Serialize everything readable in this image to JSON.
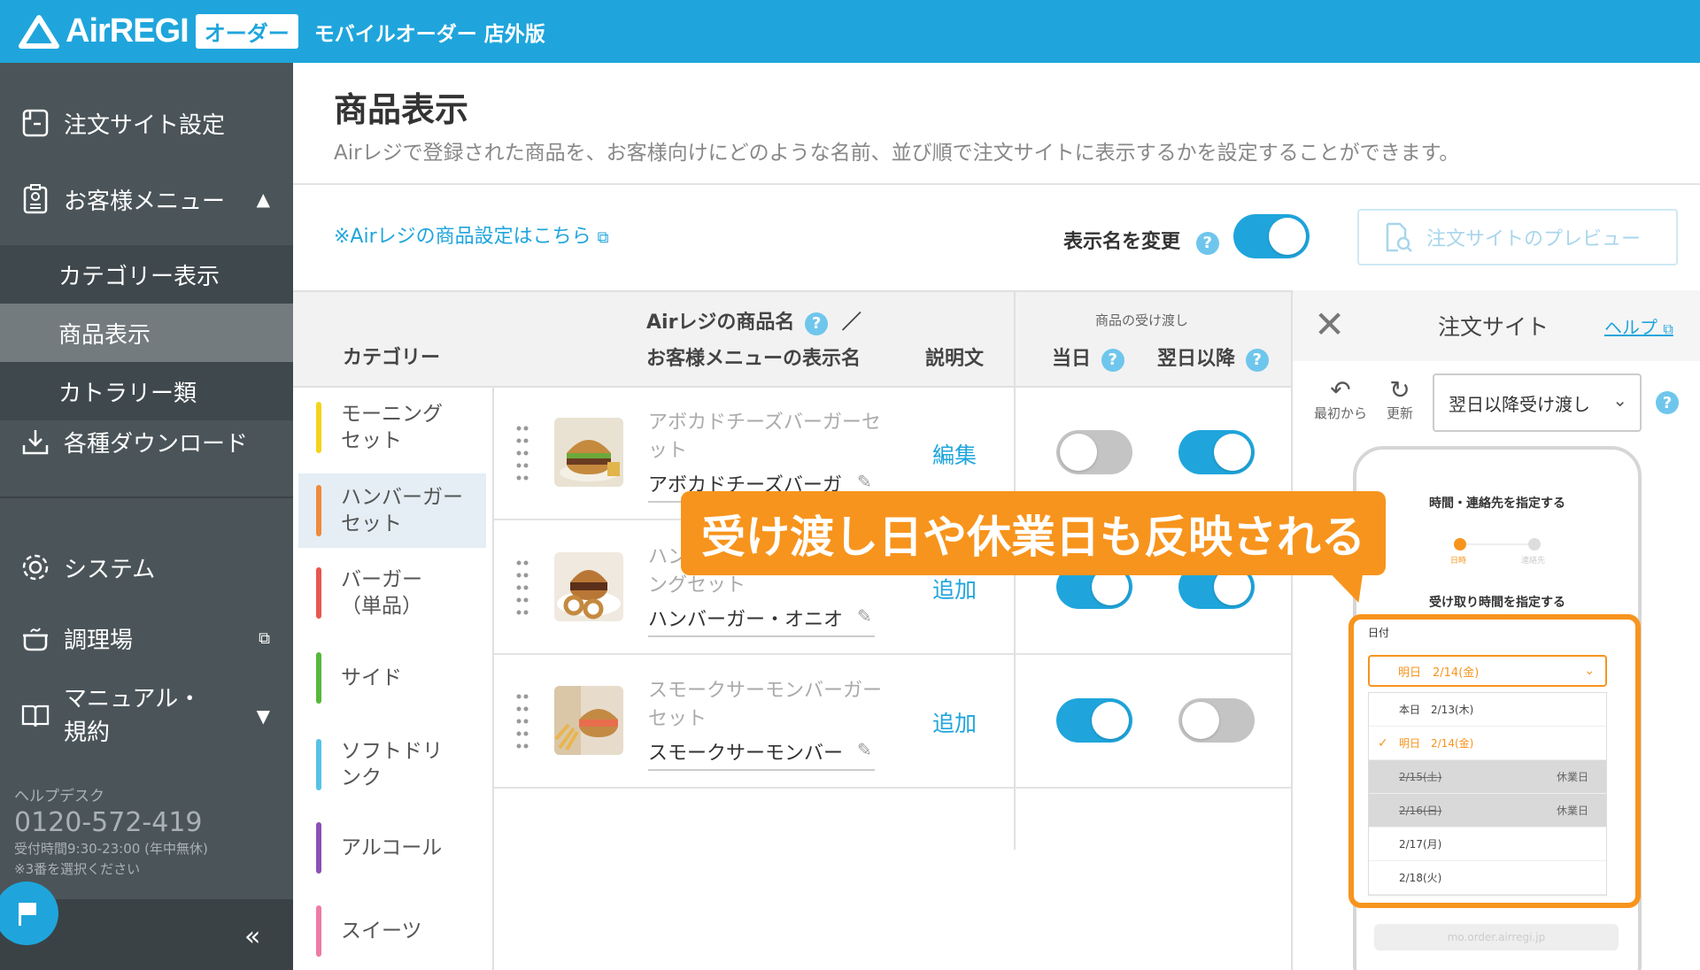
{
  "header": {
    "logo": "AirREGI",
    "badge": "オーダー",
    "subtitle": "モバイルオーダー 店外版"
  },
  "sidebar": {
    "items": [
      {
        "label": "注文サイト設定",
        "icon": "site-settings-icon"
      },
      {
        "label": "お客様メニュー",
        "icon": "menu-icon"
      },
      {
        "label": "各種ダウンロード",
        "icon": "download-icon"
      },
      {
        "label": "システム",
        "icon": "gear-icon"
      },
      {
        "label": "調理場",
        "icon": "kitchen-icon"
      },
      {
        "label": "マニュアル・",
        "label2": "規約",
        "icon": "book-icon"
      }
    ],
    "subitems": [
      {
        "label": "カテゴリー表示"
      },
      {
        "label": "商品表示"
      },
      {
        "label": "カトラリー類"
      }
    ],
    "helpdesk": {
      "title": "ヘルプデスク",
      "phone": "0120-572-419",
      "hours": "受付時間9:30-23:00 (年中無休)",
      "note": "※3番を選択ください"
    }
  },
  "main": {
    "title": "商品表示",
    "description": "Airレジで登録された商品を、お客様向けにどのような名前、並び順で注文サイトに表示するかを設定することができます。",
    "link": "※Airレジの商品設定はこちら",
    "toggle_label": "表示名を変更",
    "preview_button": "注文サイトのプレビュー"
  },
  "table": {
    "col_category": "カテゴリー",
    "col_name1": "Airレジの商品名",
    "col_slash": "／",
    "col_name2": "お客様メニューの表示名",
    "col_desc": "説明文",
    "col_handover": "商品の受け渡し",
    "col_today": "当日",
    "col_nextday": "翌日以降"
  },
  "categories": [
    {
      "label1": "モーニング",
      "label2": "セット",
      "color": "#f5d31b"
    },
    {
      "label1": "ハンバーガー",
      "label2": "セット",
      "color": "#f08a3c"
    },
    {
      "label1": "バーガー",
      "label2": "（単品）",
      "color": "#e9564f"
    },
    {
      "label1": "サイド",
      "label2": "",
      "color": "#55b83b"
    },
    {
      "label1": "ソフトドリ",
      "label2": "ンク",
      "color": "#56c2e6"
    },
    {
      "label1": "アルコール",
      "label2": "",
      "color": "#8e4fb4"
    },
    {
      "label1": "スイーツ",
      "label2": "",
      "color": "#ee7ba6"
    }
  ],
  "products": [
    {
      "name1": "アボカドチーズバーガーセ",
      "name2": "ット",
      "display": "アボカドチーズバーガ",
      "action": "編集",
      "today": false,
      "nextday": true
    },
    {
      "name1": "ハン",
      "name2": "ングセット",
      "display": "ハンバーガー・オニオ",
      "action": "追加",
      "today": true,
      "nextday": true
    },
    {
      "name1": "スモークサーモンバーガー",
      "name2": "セット",
      "display": "スモークサーモンバー",
      "action": "追加",
      "today": true,
      "nextday": false
    }
  ],
  "panel": {
    "title": "注文サイト",
    "help": "ヘルプ",
    "reset": "最初から",
    "refresh": "更新",
    "select_value": "翌日以降受け渡し",
    "phone_title": "時間・連絡先を指定する",
    "step1": "日時",
    "step2": "連絡先",
    "phone_subtitle": "受け取り時間を指定する",
    "date_label": "日付",
    "date_selected": "明日　2/14(金)",
    "options": [
      {
        "label": "本日　2/13(木)",
        "tag": "",
        "state": "normal"
      },
      {
        "label": "明日　2/14(金)",
        "tag": "",
        "state": "selected"
      },
      {
        "label": "2/15(土)",
        "tag": "休業日",
        "state": "disabled"
      },
      {
        "label": "2/16(日)",
        "tag": "休業日",
        "state": "disabled"
      },
      {
        "label": "2/17(月)",
        "tag": "",
        "state": "normal"
      },
      {
        "label": "2/18(火)",
        "tag": "",
        "state": "normal"
      }
    ],
    "url": "mo.order.airregi.jp"
  },
  "callout": "受け渡し日や休業日も反映される",
  "colors": {
    "brand": "#1fa5dc",
    "sidebar": "#4b5559",
    "accent": "#f7941d"
  }
}
